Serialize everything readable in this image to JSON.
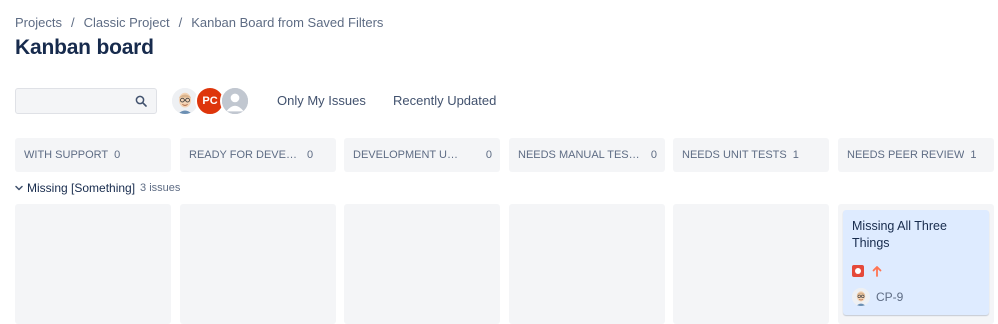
{
  "breadcrumbs": [
    "Projects",
    "Classic Project",
    "Kanban Board from Saved Filters"
  ],
  "breadcrumb_separator": "/",
  "page_title": "Kanban board",
  "search": {
    "value": "",
    "placeholder": "",
    "icon": "search-icon"
  },
  "avatars": [
    {
      "kind": "face",
      "icon": "user-face-icon"
    },
    {
      "kind": "initials",
      "initials": "PC",
      "color": "#de350b"
    },
    {
      "kind": "generic",
      "icon": "default-user-icon"
    }
  ],
  "quick_filters": [
    "Only My Issues",
    "Recently Updated"
  ],
  "columns": [
    {
      "name": "WITH SUPPORT",
      "count": "0"
    },
    {
      "name": "READY FOR DEVELOPM...",
      "count": "0"
    },
    {
      "name": "DEVELOPMENT UNDER...",
      "count": "0"
    },
    {
      "name": "NEEDS MANUAL TESTING",
      "count": "0"
    },
    {
      "name": "NEEDS UNIT TESTS",
      "count": "1"
    },
    {
      "name": "NEEDS PEER REVIEW",
      "count": "1"
    }
  ],
  "swimlane": {
    "name": "Missing [Something]",
    "count": "3 issues",
    "icon": "chevron-down-icon"
  },
  "card": {
    "title": "Missing All Three Things",
    "issue_type_icon": "bug-icon",
    "priority_icon": "priority-high-arrow-icon",
    "assignee_icon": "user-face-icon",
    "key": "CP-9",
    "column": "NEEDS PEER REVIEW"
  },
  "colors": {
    "column_bg": "#f4f5f7",
    "card_bg": "#deebff",
    "bug": "#e5493a",
    "priority_high": "#ff7452",
    "text_primary": "#172b4d",
    "text_secondary": "#5e6c84"
  }
}
